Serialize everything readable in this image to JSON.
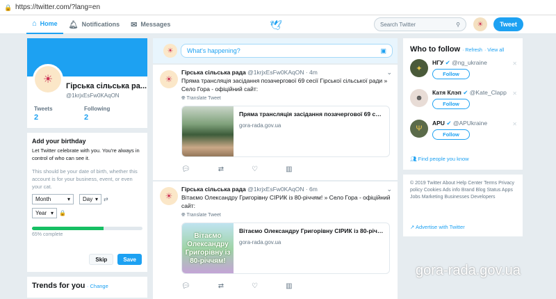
{
  "browser": {
    "url": "https://twitter.com/?lang=en"
  },
  "nav": {
    "home": "Home",
    "notifications": "Notifications",
    "messages": "Messages",
    "search_placeholder": "Search Twitter",
    "tweet_button": "Tweet"
  },
  "profile": {
    "name": "Гірська сільська ра...",
    "handle": "@1krjxEsFw0KAqON",
    "tweets_label": "Tweets",
    "tweets_count": "2",
    "following_label": "Following",
    "following_count": "2"
  },
  "birthday": {
    "title": "Add your birthday",
    "desc": "Let Twitter celebrate with you. You're always in control of who can see it.",
    "info": "This should be your date of birth, whether this account is for your business, event, or even your cat.",
    "month": "Month",
    "day": "Day",
    "year": "Year",
    "progress": 0.65,
    "progress_label": "65% complete",
    "skip": "Skip",
    "save": "Save"
  },
  "trends": {
    "title": "Trends for you",
    "change": "· Change"
  },
  "compose": {
    "placeholder": "What's happening?"
  },
  "tweets": [
    {
      "name": "Гірська сільська рада",
      "handle": "@1krjxEsFw0KAqON",
      "time": "· 4m",
      "text": "Пряма трансляція засідання позачергової 69 сесії Гірської сільської ради » Село Гора - офіційний сайт:",
      "translate": "Translate Tweet",
      "card_title": "Пряма трансляція засідання позачергової 69 сесі...",
      "card_domain": "gora-rada.gov.ua"
    },
    {
      "name": "Гірська сільська рада",
      "handle": "@1krjxEsFw0KAqON",
      "time": "· 6m",
      "text": "Вітаємо Олександру Григорівну СІРИК із 80-річчям! » Село Гора - офіційний сайт:",
      "translate": "Translate Tweet",
      "card_title": "Вітаємо Олександру Григорівну СІРИК із 80-річчя...",
      "card_domain": "gora-rada.gov.ua",
      "card_image_text": "Вітаємо Олександру Григорівну із 80-річчям!"
    }
  ],
  "who_to_follow": {
    "title": "Who to follow",
    "refresh": "· Refresh",
    "view_all": "· View all",
    "follow": "Follow",
    "find_people": "Find people you know",
    "items": [
      {
        "name": "НГУ",
        "handle": "@ng_ukraine"
      },
      {
        "name": "Катя Клэп",
        "handle": "@Kate_Clapp"
      },
      {
        "name": "APU",
        "handle": "@APUkraine"
      }
    ]
  },
  "footer": {
    "text": "© 2019 Twitter  About  Help Center  Terms  Privacy policy  Cookies  Ads info  Brand  Blog  Status  Apps  Jobs  Marketing  Businesses  Developers",
    "advertise": "Advertise with Twitter"
  },
  "watermark": "gora-rada.gov.ua",
  "colors": {
    "accent": "#1da1f2",
    "background": "#e6ecf0",
    "progress": "#17bf63"
  }
}
